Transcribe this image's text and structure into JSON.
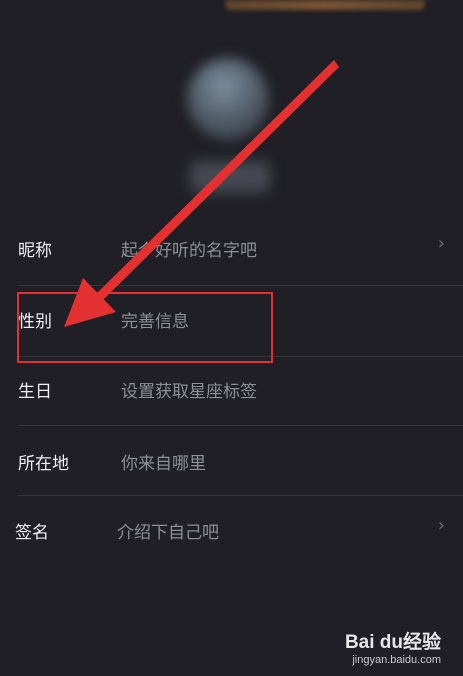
{
  "profile": {
    "rows": [
      {
        "label": "昵称",
        "value": "起个好听的名字吧",
        "chevron": "›"
      },
      {
        "label": "性别",
        "value": "完善信息",
        "chevron": ""
      },
      {
        "label": "生日",
        "value": "设置获取星座标签",
        "chevron": ""
      },
      {
        "label": "所在地",
        "value": "你来自哪里",
        "chevron": ""
      },
      {
        "label": "签名",
        "value": "介绍下自己吧",
        "chevron": "›"
      }
    ]
  },
  "watermark": {
    "logo": "Bai du经验",
    "url": "jingyan.baidu.com"
  },
  "colors": {
    "background": "#1f1f25",
    "annotation": "#e33030"
  }
}
